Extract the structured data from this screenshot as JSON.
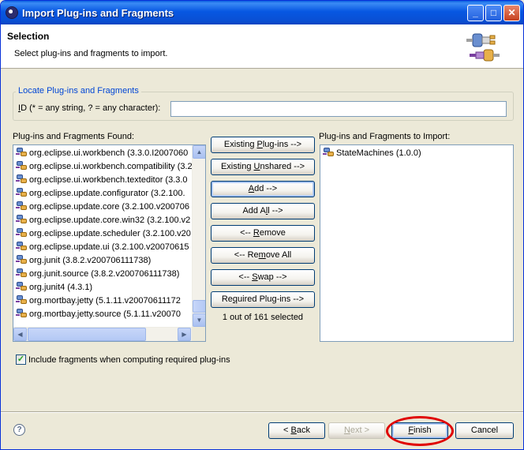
{
  "window": {
    "title": "Import Plug-ins and Fragments",
    "controls": {
      "minimize": "_",
      "maximize": "□",
      "close": "✕"
    }
  },
  "banner": {
    "heading": "Selection",
    "description": "Select plug-ins and fragments to import.",
    "image_icon": "plugin-wizard-icon"
  },
  "locate_group": {
    "title": "Locate Plug-ins and Fragments",
    "id_label_prefix": "",
    "id_label_mnemonic": "I",
    "id_label_rest": "D (* = any string, ? = any character):",
    "id_value": ""
  },
  "found_list": {
    "label": "Plug-ins and Fragments Found:",
    "items": [
      "org.eclipse.ui.workbench (3.3.0.I2007060",
      "org.eclipse.ui.workbench.compatibility (3.2",
      "org.eclipse.ui.workbench.texteditor (3.3.0",
      "org.eclipse.update.configurator (3.2.100.",
      "org.eclipse.update.core (3.2.100.v200706",
      "org.eclipse.update.core.win32 (3.2.100.v2",
      "org.eclipse.update.scheduler (3.2.100.v20",
      "org.eclipse.update.ui (3.2.100.v20070615",
      "org.junit (3.8.2.v200706111738)",
      "org.junit.source (3.8.2.v200706111738)",
      "org.junit4 (4.3.1)",
      "org.mortbay.jetty (5.1.11.v20070611172",
      "org.mortbay.jetty.source (5.1.11.v20070"
    ],
    "scroll_up": "▲",
    "scroll_down": "▼",
    "scroll_left": "◀",
    "scroll_right": "▶"
  },
  "actions": {
    "existing_plugins": {
      "mnemonic_before": "Existing ",
      "mnemonic": "P",
      "after": "lug-ins -->"
    },
    "existing_unshared": {
      "mnemonic_before": "Existing ",
      "mnemonic": "U",
      "after": "nshared -->"
    },
    "add": {
      "mnemonic_before": "",
      "mnemonic": "A",
      "after": "dd -->"
    },
    "add_all": {
      "mnemonic_before": "Add A",
      "mnemonic": "l",
      "after": "l -->"
    },
    "remove": {
      "mnemonic_before": "<-- ",
      "mnemonic": "R",
      "after": "emove"
    },
    "remove_all": {
      "mnemonic_before": "<-- Re",
      "mnemonic": "m",
      "after": "ove All"
    },
    "swap": {
      "mnemonic_before": "<-- ",
      "mnemonic": "S",
      "after": "wap -->"
    },
    "required_plugins": {
      "mnemonic_before": "Re",
      "mnemonic": "q",
      "after": "uired Plug-ins -->"
    },
    "status": "1 out of 161 selected"
  },
  "import_list": {
    "label": "Plug-ins and Fragments to Import:",
    "items": [
      "StateMachines (1.0.0)"
    ]
  },
  "include_fragments": {
    "checked": true,
    "check_mark": "✓",
    "label": "Include fragments when computing required plug-ins"
  },
  "footer": {
    "help_icon": "?",
    "back": {
      "before": "< ",
      "mnemonic": "B",
      "after": "ack"
    },
    "next": {
      "before": "",
      "mnemonic": "N",
      "after": "ext >"
    },
    "finish": {
      "before": "",
      "mnemonic": "F",
      "after": "inish"
    },
    "cancel": "Cancel"
  },
  "colors": {
    "title_bar": "#0757e2",
    "group_title": "#0046d5",
    "annotation": "#e00000"
  }
}
